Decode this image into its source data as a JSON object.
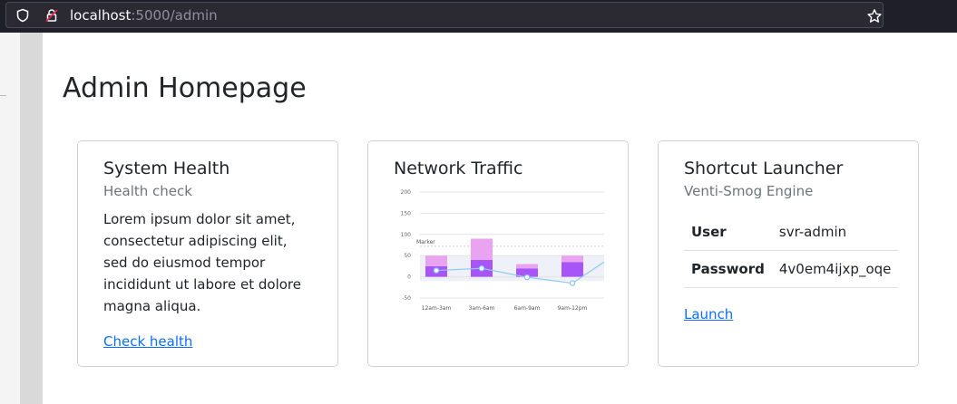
{
  "browser": {
    "url_host": "localhost",
    "url_path": ":5000/admin"
  },
  "page": {
    "title": "Admin Homepage"
  },
  "cards": {
    "health": {
      "title": "System Health",
      "subtitle": "Health check",
      "text": "Lorem ipsum dolor sit amet, consectetur adipiscing elit, sed do eiusmod tempor incididunt ut labore et dolore magna aliqua.",
      "link": "Check health"
    },
    "traffic": {
      "title": "Network Traffic"
    },
    "launcher": {
      "title": "Shortcut Launcher",
      "subtitle": "Venti-Smog Engine",
      "rows": [
        {
          "key": "User",
          "value": "svr-admin"
        },
        {
          "key": "Password",
          "value": "4v0em4ijxp_oqe"
        }
      ],
      "link": "Launch"
    }
  },
  "chart_data": {
    "type": "bar",
    "categories": [
      "12am-3am",
      "3am-6am",
      "6am-9am",
      "9am-12pm"
    ],
    "series": [
      {
        "values": [
          25,
          40,
          20,
          35
        ],
        "color": "#a855f7"
      },
      {
        "values": [
          25,
          50,
          10,
          15
        ],
        "color": "#e9a3f0"
      }
    ],
    "line": {
      "values": [
        15,
        20,
        -1,
        -15
      ],
      "color": "#8ec9ef"
    },
    "band": [
      -10,
      50
    ],
    "marker": {
      "label": "Marker",
      "value": 72
    },
    "yticks": [
      200,
      150,
      100,
      50,
      0,
      -50
    ],
    "ylim": [
      -50,
      200
    ]
  }
}
